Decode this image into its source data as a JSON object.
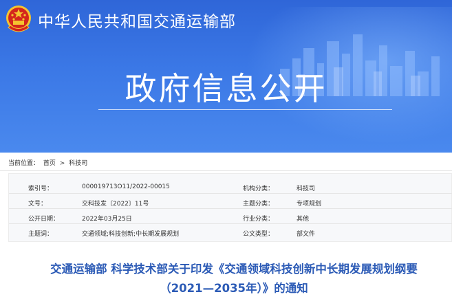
{
  "header": {
    "site_title": "中华人民共和国交通运输部",
    "banner_title": "政府信息公开"
  },
  "breadcrumb": {
    "label": "当前位置：",
    "home": "首页",
    "separator": ">",
    "current": "科技司"
  },
  "info": {
    "rows": [
      {
        "label1": "索引号：",
        "value1": "000019713O11/2022-00015",
        "label2": "机构分类：",
        "value2": "科技司"
      },
      {
        "label1": "文号：",
        "value1": "交科技发〔2022〕11号",
        "label2": "主题分类：",
        "value2": "专项规划"
      },
      {
        "label1": "公开日期：",
        "value1": "2022年03月25日",
        "label2": "行业分类：",
        "value2": "其他"
      },
      {
        "label1": "主题词：",
        "value1": "交通领域;科技创新;中长期发展规划",
        "label2": "公文类型：",
        "value2": "部文件"
      }
    ]
  },
  "document": {
    "title_line1": "交通运输部 科学技术部关于印发《交通领域科技创新中长期发展规划纲要",
    "title_line2": "（2021—2035年）》的通知"
  },
  "colors": {
    "banner_blue": "#3b78e6",
    "title_blue": "#2c5bb6",
    "emblem_red": "#d4261c",
    "emblem_gold": "#f4c430"
  }
}
